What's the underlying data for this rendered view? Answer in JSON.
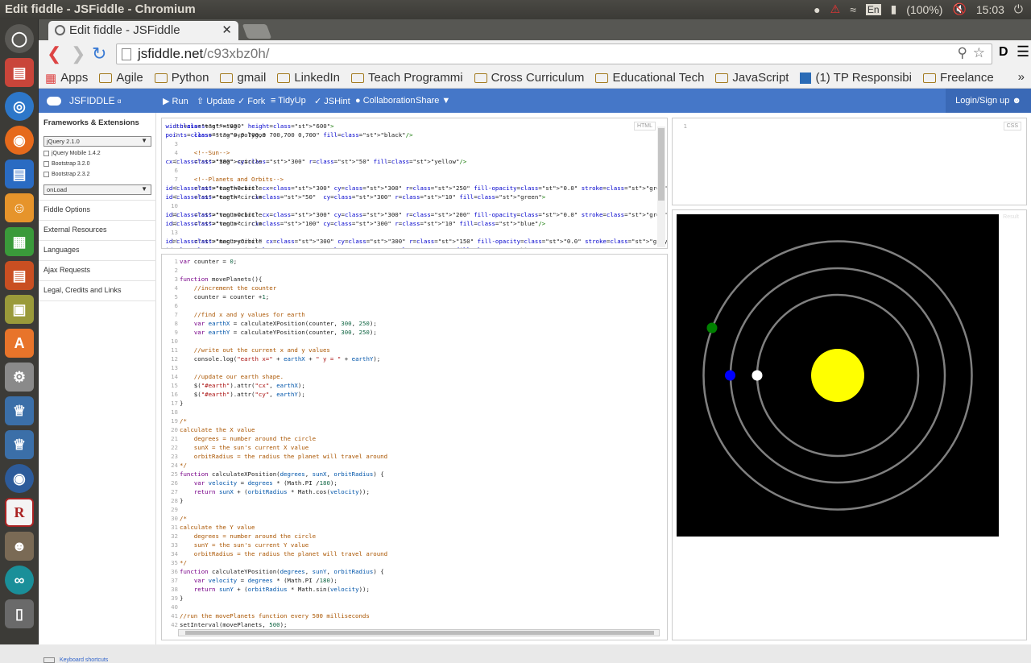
{
  "os": {
    "window_title": "Edit fiddle - JSFiddle - Chromium",
    "keyboard": "En",
    "battery": "(100%)",
    "clock": "15:03"
  },
  "browser": {
    "tab_title": "Edit fiddle - JSFiddle",
    "url_host": "jsfiddle.net",
    "url_path": "/c93xbz0h/",
    "bookmarks": [
      "Apps",
      "Agile",
      "Python",
      "gmail",
      "LinkedIn",
      "Teach Programmi",
      "Cross Curriculum",
      "Educational Tech",
      "JavaScript",
      "(1) TP Responsibi",
      "Freelance"
    ],
    "more": "»"
  },
  "jsfiddle": {
    "logo": "JSFIDDLE",
    "logo_suffix": "α",
    "buttons": [
      "Run",
      "Update",
      "Fork",
      "TidyUp",
      "JSHint",
      "Collaboration",
      "Share"
    ],
    "login": "Login/Sign up"
  },
  "sidebar": {
    "heading": "Frameworks & Extensions",
    "framework": "jQuery 2.1.0",
    "checkboxes": [
      "jQuery Mobile 1.4.2",
      "Bootstrap 3.2.0",
      "Bootstrap 2.3.2"
    ],
    "load": "onLoad",
    "items": [
      "Fiddle Options",
      "External Resources",
      "Languages",
      "Ajax Requests",
      "Legal, Credits and Links"
    ],
    "shortcuts": "Keyboard shortcuts"
  },
  "panels": {
    "html": "HTML",
    "css": "CSS",
    "result": "Result"
  },
  "html_code": [
    "<svg width=\"800\" height=\"600\">",
    "    <polygon points=\"0,0 700,0 700,700 0,700\" fill=\"black\"/>",
    "",
    "    <!--Sun-->",
    "    <circle cx=\"300\" cy=\"300\" r=\"50\" fill=\"yellow\"/>",
    "",
    "    <!--Planets and Orbits-->",
    "    <circle id=\"earthOrbit\" cx=\"300\" cy=\"300\" r=\"250\" fill-opacity=\"0.0\" stroke=\"grey\" stroke-width=\"5\"/>",
    "    <circle id=\"earth\"   cx=\"50\"  cy=\"300\" r=\"10\" fill=\"green\">",
    "",
    "    <circle id=\"venusOrbit\" cx=\"300\" cy=\"300\" r=\"200\" fill-opacity=\"0.0\" stroke=\"grey\" stroke-width=\"5\"/>",
    "    <circle id=\"venus\"   cx=\"100\" cy=\"300\" r=\"10\" fill=\"blue\"/>",
    "",
    "    <circle id=\"mecuryOrbit\" cx=\"300\" cy=\"300\" r=\"150\" fill-opacity=\"0.0\" stroke=\"grey\" stroke-width=\"5\"/>",
    "    <circle id=\"mecury\" cx=\"150\" cy=\"300\" r=\"10\" fill=\"white\"/>"
  ],
  "css_code": [
    ""
  ],
  "js_code": [
    "var counter = 0;",
    "",
    "function movePlanets(){",
    "    //increment the counter",
    "    counter = counter +1;",
    "",
    "    //find x and y values for earth",
    "    var earthX = calculateXPosition(counter, 300, 250);",
    "    var earthY = calculateYPosition(counter, 300, 250);",
    "",
    "    //write out the current x and y values",
    "    console.log(\"earth x=\" + earthX + \" y = \" + earthY);",
    "",
    "    //update our earth shape.",
    "    $(\"#earth\").attr(\"cx\", earthX);",
    "    $(\"#earth\").attr(\"cy\", earthY);",
    "}",
    "",
    "/*",
    "calculate the X value",
    "    degrees = number around the circle",
    "    sunX = the sun's current X value",
    "    orbitRadius = the radius the planet will travel around",
    "*/",
    "function calculateXPosition(degrees, sunX, orbitRadius) {",
    "    var velocity = degrees * (Math.PI /180);",
    "    return sunX + (orbitRadius * Math.cos(velocity));",
    "}",
    "",
    "/*",
    "calculate the Y value",
    "    degrees = number around the circle",
    "    sunY = the sun's current Y value",
    "    orbitRadius = the radius the planet will travel around",
    "*/",
    "function calculateYPosition(degrees, sunY, orbitRadius) {",
    "    var velocity = degrees * (Math.PI /180);",
    "    return sunY + (orbitRadius * Math.sin(velocity));",
    "}",
    "",
    "//run the movePlanets function every 500 milliseconds",
    "setInterval(movePlanets, 500);"
  ],
  "colors": {
    "jsfiddle_blue": "#4577c8",
    "sun": "yellow",
    "earth": "green",
    "venus": "blue",
    "mecury": "white",
    "orbit": "grey"
  }
}
